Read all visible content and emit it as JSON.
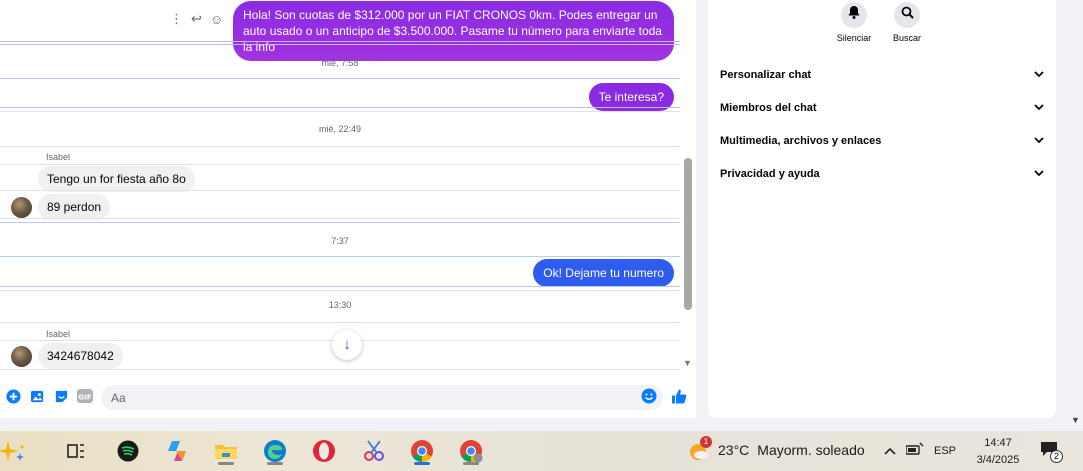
{
  "chat": {
    "messages": {
      "m1": "Hola! Son cuotas de $312.000 por un FIAT CRONOS 0km. Podes entregar un auto usado o un anticipo de $3.500.000. Pasame tu número para enviarte toda la info",
      "t1": "mié, 7:58",
      "m2": "Te interesa?",
      "t2": "mié, 22:49",
      "sender1": "Isabel",
      "m3": "Tengo un for fiesta año 8o",
      "m4": "89 perdon",
      "t3": "7:37",
      "m5": "Ok! Dejame tu numero",
      "t4": "13:30",
      "sender2": "Isabel",
      "m6": "3424678042"
    },
    "composer": {
      "placeholder": "Aa"
    }
  },
  "info_panel": {
    "actions": [
      {
        "label": "Silenciar",
        "icon": "bell-icon"
      },
      {
        "label": "Buscar",
        "icon": "search-icon"
      }
    ],
    "sections": [
      "Personalizar chat",
      "Miembros del chat",
      "Multimedia, archivos y enlaces",
      "Privacidad y ayuda"
    ]
  },
  "taskbar": {
    "weather": {
      "temp": "23°C",
      "desc": "Mayorm. soleado",
      "alert": "1"
    },
    "lang": "ESP",
    "time": "14:47",
    "date": "3/4/2025",
    "notifications": "2"
  },
  "colors": {
    "outgoing_purple": "#8a2be2",
    "outgoing_blue": "#2f5cf0",
    "accent": "#0a7cff"
  }
}
